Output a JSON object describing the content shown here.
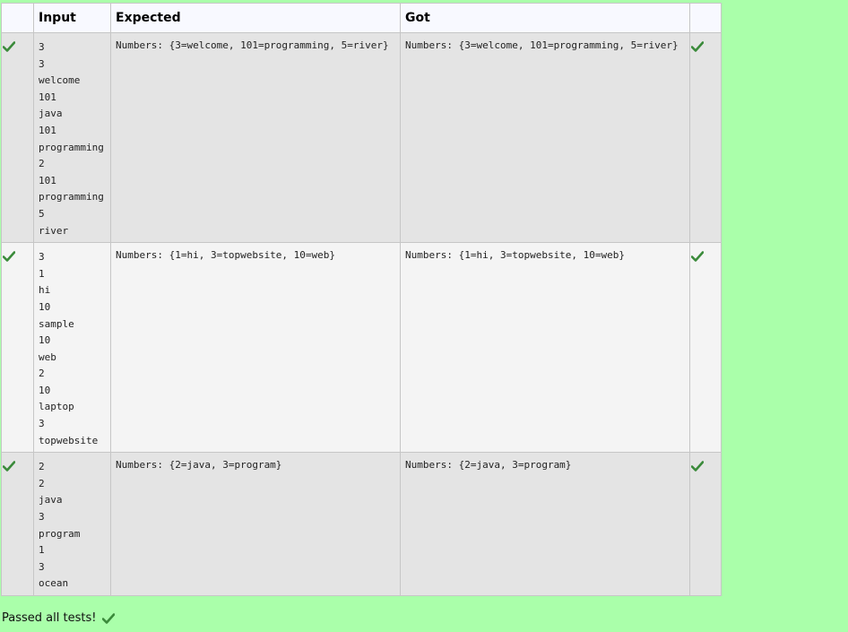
{
  "colors": {
    "background": "#aaffaa",
    "check": "#3a8a3a",
    "header_bg": "#f8f9ff"
  },
  "headers": {
    "status": "",
    "input": "Input",
    "expected": "Expected",
    "got": "Got",
    "result": ""
  },
  "rows": [
    {
      "input": [
        "3",
        "3",
        "welcome",
        "101",
        "java",
        "101",
        "programming",
        "2",
        "101",
        "programming",
        "5",
        "river"
      ],
      "expected": "Numbers: {3=welcome, 101=programming, 5=river}",
      "got": "Numbers: {3=welcome, 101=programming, 5=river}",
      "passed_icon": "check-icon"
    },
    {
      "input": [
        "3",
        "1",
        "hi",
        "10",
        "sample",
        "10",
        "web",
        "2",
        "10",
        "laptop",
        "3",
        "topwebsite"
      ],
      "expected": "Numbers: {1=hi, 3=topwebsite, 10=web}",
      "got": "Numbers: {1=hi, 3=topwebsite, 10=web}",
      "passed_icon": "check-icon"
    },
    {
      "input": [
        "2",
        "2",
        "java",
        "3",
        "program",
        "1",
        "3",
        "ocean"
      ],
      "expected": "Numbers: {2=java, 3=program}",
      "got": "Numbers: {2=java, 3=program}",
      "passed_icon": "check-icon"
    }
  ],
  "footer": {
    "message": "Passed all tests!",
    "icon": "check-icon"
  }
}
